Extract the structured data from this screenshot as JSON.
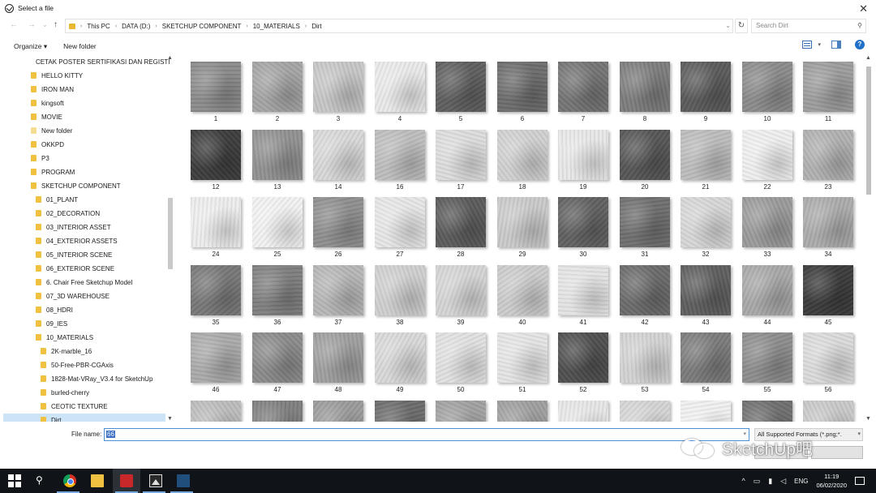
{
  "dialog": {
    "title": "Select a file",
    "close_glyph": "✕"
  },
  "nav": {
    "back_glyph": "←",
    "forward_glyph": "→",
    "dropdown_glyph": "⌄",
    "up_glyph": "↑"
  },
  "breadcrumb": [
    "This PC",
    "DATA (D:)",
    "SKETCHUP COMPONENT",
    "10_MATERIALS",
    "Dirt"
  ],
  "search": {
    "placeholder": "Search Dirt"
  },
  "toolbar": {
    "organize_label": "Organize ▾",
    "new_folder_label": "New folder",
    "help_label": "?"
  },
  "sidebar": {
    "items": [
      {
        "label": "CETAK POSTER SERTIFIKASI DAN REGISTI",
        "level": 0
      },
      {
        "label": "HELLO KITTY",
        "level": 0
      },
      {
        "label": "IRON MAN",
        "level": 0
      },
      {
        "label": "kingsoft",
        "level": 0
      },
      {
        "label": "MOVIE",
        "level": 0
      },
      {
        "label": "New folder",
        "level": 0,
        "pale": true
      },
      {
        "label": "OKKPD",
        "level": 0
      },
      {
        "label": "P3",
        "level": 0
      },
      {
        "label": "PROGRAM",
        "level": 0
      },
      {
        "label": "SKETCHUP COMPONENT",
        "level": 0
      },
      {
        "label": "01_PLANT",
        "level": 1
      },
      {
        "label": "02_DECORATION",
        "level": 1
      },
      {
        "label": "03_INTERIOR ASSET",
        "level": 1
      },
      {
        "label": "04_EXTERIOR ASSETS",
        "level": 1
      },
      {
        "label": "05_INTERIOR SCENE",
        "level": 1
      },
      {
        "label": "06_EXTERIOR SCENE",
        "level": 1
      },
      {
        "label": "6. Chair Free Sketchup Model",
        "level": 1
      },
      {
        "label": "07_3D WAREHOUSE",
        "level": 1
      },
      {
        "label": "08_HDRI",
        "level": 1
      },
      {
        "label": "09_IES",
        "level": 1
      },
      {
        "label": "10_MATERIALS",
        "level": 1
      },
      {
        "label": "2K-marble_16",
        "level": 2
      },
      {
        "label": "50-Free-PBR-CGAxis",
        "level": 2
      },
      {
        "label": "1828-Mat-VRay_V3.4 for SketchUp",
        "level": 2
      },
      {
        "label": "burled-cherry",
        "level": 2
      },
      {
        "label": "CEOTIC TEXTURE",
        "level": 2
      },
      {
        "label": "Dirt",
        "level": 2,
        "selected": true
      }
    ]
  },
  "files": [
    {
      "label": "1",
      "tone": "#8a8a8a"
    },
    {
      "label": "2",
      "tone": "#a4a4a4"
    },
    {
      "label": "3",
      "tone": "#c6c6c6"
    },
    {
      "label": "4",
      "tone": "#e9e9e9"
    },
    {
      "label": "5",
      "tone": "#5e5e5e"
    },
    {
      "label": "6",
      "tone": "#6c6c6c"
    },
    {
      "label": "7",
      "tone": "#747474"
    },
    {
      "label": "8",
      "tone": "#7c7c7c"
    },
    {
      "label": "9",
      "tone": "#5a5a5a"
    },
    {
      "label": "10",
      "tone": "#8a8a8a"
    },
    {
      "label": "11",
      "tone": "#9c9c9c"
    },
    {
      "label": "12",
      "tone": "#3c3c3c"
    },
    {
      "label": "13",
      "tone": "#909090"
    },
    {
      "label": "14",
      "tone": "#d8d8d8"
    },
    {
      "label": "16",
      "tone": "#bdbdbd"
    },
    {
      "label": "17",
      "tone": "#dcdcdc"
    },
    {
      "label": "18",
      "tone": "#d0d0d0"
    },
    {
      "label": "19",
      "tone": "#e7e7e7"
    },
    {
      "label": "20",
      "tone": "#555555"
    },
    {
      "label": "21",
      "tone": "#bcbcbc"
    },
    {
      "label": "22",
      "tone": "#eeeeee"
    },
    {
      "label": "23",
      "tone": "#b0b0b0"
    },
    {
      "label": "24",
      "tone": "#ececec"
    },
    {
      "label": "25",
      "tone": "#f1f1f1"
    },
    {
      "label": "26",
      "tone": "#8e8e8e"
    },
    {
      "label": "27",
      "tone": "#e6e6e6"
    },
    {
      "label": "28",
      "tone": "#5a5a5a"
    },
    {
      "label": "29",
      "tone": "#c9c9c9"
    },
    {
      "label": "30",
      "tone": "#606060"
    },
    {
      "label": "31",
      "tone": "#6e6e6e"
    },
    {
      "label": "32",
      "tone": "#d6d6d6"
    },
    {
      "label": "33",
      "tone": "#9a9a9a"
    },
    {
      "label": "34",
      "tone": "#ababab"
    },
    {
      "label": "35",
      "tone": "#777777"
    },
    {
      "label": "36",
      "tone": "#7e7e7e"
    },
    {
      "label": "37",
      "tone": "#b6b6b6"
    },
    {
      "label": "38",
      "tone": "#cfcfcf"
    },
    {
      "label": "39",
      "tone": "#d4d4d4"
    },
    {
      "label": "40",
      "tone": "#cbcbcb"
    },
    {
      "label": "41",
      "tone": "#e3e3e3"
    },
    {
      "label": "42",
      "tone": "#6a6a6a"
    },
    {
      "label": "43",
      "tone": "#5e5e5e"
    },
    {
      "label": "44",
      "tone": "#a8a8a8"
    },
    {
      "label": "45",
      "tone": "#3a3a3a"
    },
    {
      "label": "46",
      "tone": "#aaaaaa"
    },
    {
      "label": "47",
      "tone": "#8a8a8a"
    },
    {
      "label": "48",
      "tone": "#9e9e9e"
    },
    {
      "label": "49",
      "tone": "#d8d8d8"
    },
    {
      "label": "50",
      "tone": "#e0e0e0"
    },
    {
      "label": "51",
      "tone": "#e4e4e4"
    },
    {
      "label": "52",
      "tone": "#4e4e4e"
    },
    {
      "label": "53",
      "tone": "#d2d2d2"
    },
    {
      "label": "54",
      "tone": "#7a7a7a"
    },
    {
      "label": "55",
      "tone": "#8c8c8c"
    },
    {
      "label": "56",
      "tone": "#dadada"
    },
    {
      "label": "",
      "tone": "#bcbcbc"
    },
    {
      "label": "",
      "tone": "#7e7e7e"
    },
    {
      "label": "",
      "tone": "#9a9a9a"
    },
    {
      "label": "",
      "tone": "#6a6a6a"
    },
    {
      "label": "",
      "tone": "#a0a0a0"
    },
    {
      "label": "",
      "tone": "#9e9e9e"
    },
    {
      "label": "",
      "tone": "#e6e6e6"
    },
    {
      "label": "",
      "tone": "#d4d4d4"
    },
    {
      "label": "",
      "tone": "#efefef"
    },
    {
      "label": "",
      "tone": "#6e6e6e"
    },
    {
      "label": "",
      "tone": "#c8c8c8"
    }
  ],
  "footer": {
    "file_name_label": "File name:",
    "file_name_value": "66",
    "filter_value": "All Supported Formats (*.png;*.",
    "open_label": "",
    "cancel_label": ""
  },
  "watermark": {
    "text": "SketchUp吧"
  },
  "taskbar": {
    "tray_chevron": "^",
    "language": "ENG",
    "time": "11:19",
    "date": "06/02/2020"
  },
  "colors": {
    "selection": "#cde4f7",
    "accent": "#1e70c8",
    "folder": "#f0c040",
    "taskbar": "#101418"
  }
}
